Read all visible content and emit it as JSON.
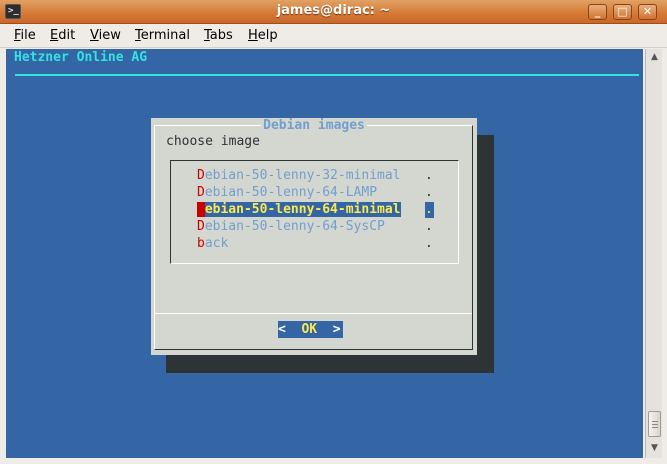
{
  "window": {
    "title": "james@dirac: ~",
    "icon_label": ">_",
    "controls": {
      "minimize": "_",
      "maximize": "□",
      "close": "✕"
    }
  },
  "menubar": [
    {
      "mnemonic": "F",
      "rest": "ile"
    },
    {
      "mnemonic": "E",
      "rest": "dit"
    },
    {
      "mnemonic": "V",
      "rest": "iew"
    },
    {
      "mnemonic": "T",
      "rest": "erminal"
    },
    {
      "mnemonic": "T",
      "rest": "abs"
    },
    {
      "mnemonic": "H",
      "rest": "elp"
    }
  ],
  "terminal": {
    "backtitle": "Hetzner Online AG",
    "dialog": {
      "title": "Debian images",
      "prompt": "choose image",
      "items": [
        {
          "hotkey": "D",
          "rest": "ebian-50-lenny-32-minimal",
          "dot": "."
        },
        {
          "hotkey": "D",
          "rest": "ebian-50-lenny-64-LAMP",
          "dot": "."
        },
        {
          "hotkey": "D",
          "rest": "ebian-50-lenny-64-minimal",
          "dot": ".",
          "selected": true
        },
        {
          "hotkey": "D",
          "rest": "ebian-50-lenny-64-SysCP",
          "dot": "."
        },
        {
          "hotkey": "b",
          "rest": "ack",
          "dot": "."
        }
      ],
      "ok_button": {
        "left": "<",
        "label": "OK",
        "right": ">"
      }
    }
  },
  "scrollbar": {
    "up": "▲",
    "down": "▼"
  },
  "colors": {
    "terminal_bg": "#3465a4",
    "dialog_bg": "#d3d7cf",
    "backtitle": "#34e2e2",
    "hotkey": "#cc0000",
    "selected_text": "#fce94f",
    "title_bar": "#d77b37"
  }
}
